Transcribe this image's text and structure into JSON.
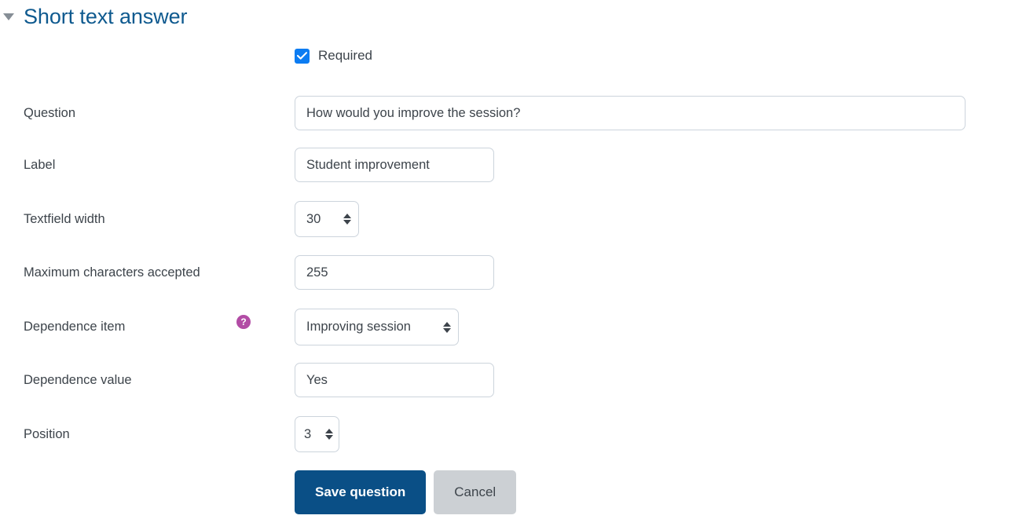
{
  "section": {
    "title": "Short text answer",
    "collapse_icon": "caret-down-icon",
    "expanded": true
  },
  "required": {
    "label": "Required",
    "checked": true,
    "icon": "checkmark-icon"
  },
  "fields": [
    {
      "label": "Question",
      "control": "text",
      "value": "How would you improve the session?",
      "name": "question"
    },
    {
      "label": "Label",
      "control": "text",
      "value": "Student improvement",
      "name": "label"
    },
    {
      "label": "Textfield width",
      "control": "select",
      "value": "30",
      "name": "textfield-width"
    },
    {
      "label": "Maximum characters accepted",
      "control": "text",
      "value": "255",
      "name": "maximum-characters-accepted"
    },
    {
      "label": "Dependence item",
      "control": "select",
      "value": "Improving session",
      "name": "dependence-item",
      "help": {
        "icon": "help-question-icon",
        "glyph": "?",
        "color": "#b24ca5"
      }
    },
    {
      "label": "Dependence value",
      "control": "text",
      "value": "Yes",
      "name": "dependence-value"
    },
    {
      "label": "Position",
      "control": "select",
      "value": "3",
      "name": "position"
    }
  ],
  "buttons": {
    "save": "Save question",
    "cancel": "Cancel"
  },
  "colors": {
    "title": "#0f5a8f",
    "primary_button": "#0a4f86",
    "secondary_button": "#ccd0d4",
    "checkbox": "#0c7cf2",
    "help_icon": "#b24ca5",
    "border": "#ccd4dc",
    "text": "#3d444b"
  }
}
